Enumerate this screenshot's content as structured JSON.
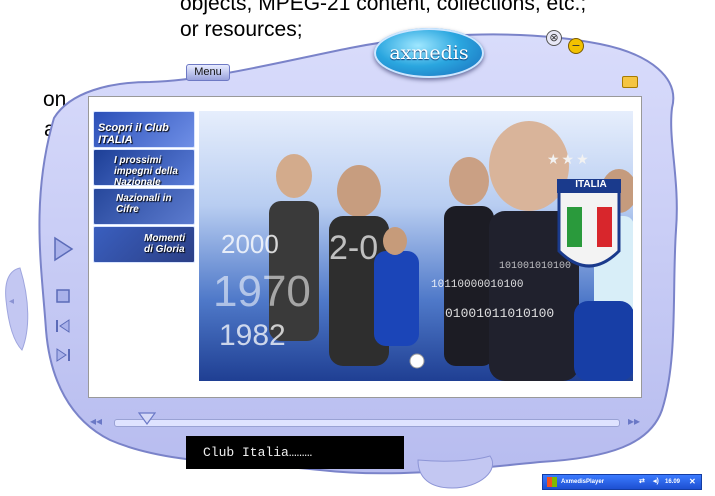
{
  "background_text": {
    "line1": "objects, MPEG-21 content, collections, etc.;",
    "line2": "or resources;",
    "line3": "on",
    "line4": "age;"
  },
  "player": {
    "menu_label": "Menu",
    "logo_text": "axmedis",
    "caption": "Club Italia………"
  },
  "content": {
    "side_buttons": [
      {
        "label": "Scopri il Club ITALIA"
      },
      {
        "label": "I prossimi impegni della Nazionale"
      },
      {
        "label": "Nazionali in Cifre"
      },
      {
        "label": "Momenti di Gloria"
      }
    ],
    "banner_numbers": [
      "2000",
      "1970",
      "1982",
      "2-0"
    ],
    "banner_binary": [
      "10110000010100",
      "01001011010100",
      "101001010100"
    ],
    "badge_text": "ITALIA"
  },
  "taskbar": {
    "app_label": "AxmedisPlayer",
    "clock": "16.09"
  },
  "colors": {
    "shell_fill": "#c9cdf6",
    "shell_edge": "#7a83c9",
    "accent_blue": "#1a4fa8"
  }
}
